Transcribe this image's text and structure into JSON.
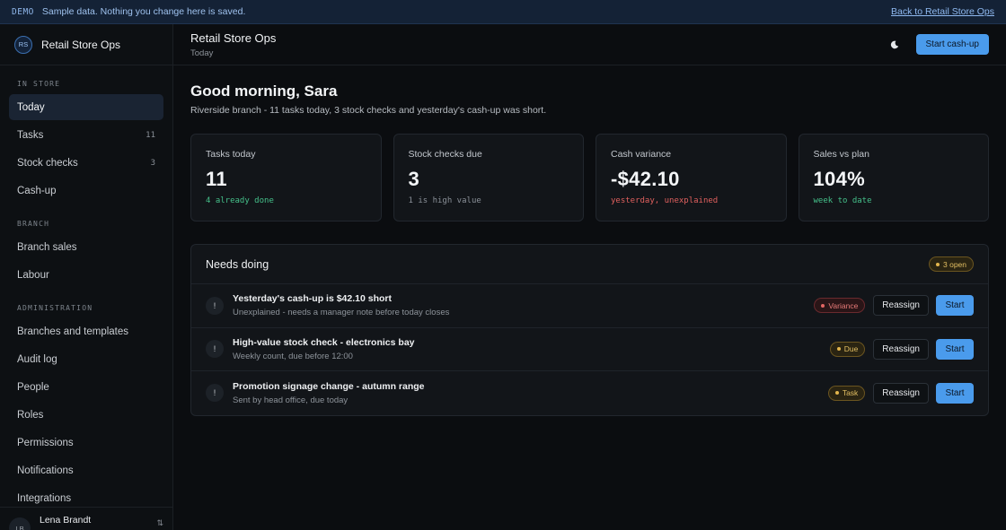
{
  "banner": {
    "tag": "DEMO",
    "message": "Sample data. Nothing you change here is saved.",
    "link": "Back to Retail Store Ops"
  },
  "brand": {
    "initials": "RS",
    "name": "Retail Store Ops"
  },
  "nav": {
    "sections": [
      {
        "label": "IN STORE",
        "items": [
          {
            "label": "Today",
            "active": true
          },
          {
            "label": "Tasks",
            "count": "11"
          },
          {
            "label": "Stock checks",
            "count": "3"
          },
          {
            "label": "Cash-up"
          }
        ]
      },
      {
        "label": "BRANCH",
        "items": [
          {
            "label": "Branch sales"
          },
          {
            "label": "Labour"
          }
        ]
      },
      {
        "label": "ADMINISTRATION",
        "items": [
          {
            "label": "Branches and templates"
          },
          {
            "label": "Audit log"
          },
          {
            "label": "People"
          },
          {
            "label": "Roles"
          },
          {
            "label": "Permissions"
          },
          {
            "label": "Notifications"
          },
          {
            "label": "Integrations"
          }
        ]
      }
    ]
  },
  "user": {
    "initials": "LB",
    "name": "Lena Brandt",
    "icon": "swap-icon"
  },
  "topbar": {
    "title": "Retail Store Ops",
    "subtitle": "Today",
    "theme_icon": "moon-icon",
    "primary_button": "Start cash-up"
  },
  "greeting": {
    "title": "Good morning, Sara",
    "subtitle": "Riverside branch - 11 tasks today, 3 stock checks and yesterday's cash-up was short."
  },
  "stats": [
    {
      "label": "Tasks today",
      "value": "11",
      "note": "4 already done",
      "tone": "green"
    },
    {
      "label": "Stock checks due",
      "value": "3",
      "note": "1 is high value",
      "tone": "grey"
    },
    {
      "label": "Cash variance",
      "value": "-$42.10",
      "note": "yesterday, unexplained",
      "tone": "red"
    },
    {
      "label": "Sales vs plan",
      "value": "104%",
      "note": "week to date",
      "tone": "green"
    }
  ],
  "panel": {
    "title": "Needs doing",
    "badge": "3 open",
    "reassign_label": "Reassign",
    "start_label": "Start",
    "rows": [
      {
        "icon": "!",
        "title": "Yesterday's cash-up is $42.10 short",
        "subtitle": "Unexplained - needs a manager note before today closes",
        "pill": "Variance",
        "pill_tone": "red"
      },
      {
        "icon": "!",
        "title": "High-value stock check - electronics bay",
        "subtitle": "Weekly count, due before 12:00",
        "pill": "Due",
        "pill_tone": "amber"
      },
      {
        "icon": "!",
        "title": "Promotion signage change - autumn range",
        "subtitle": "Sent by head office, due today",
        "pill": "Task",
        "pill_tone": "amber"
      }
    ]
  }
}
